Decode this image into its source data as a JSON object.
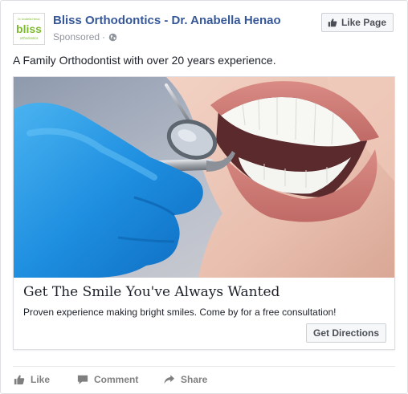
{
  "post": {
    "page_name": "Bliss Orthodontics - Dr. Anabella Henao",
    "sponsored_label": "Sponsored",
    "separator": "·",
    "like_page_label": "Like Page",
    "body_text": "A Family Orthodontist with over 20 years experience.",
    "logo": {
      "top_text": "Dr. Anabella Henao",
      "main_text": "bliss",
      "bottom_text": "orthodontics",
      "color": "#7dbb2e"
    }
  },
  "ad": {
    "image_icon": "dental-exam-photo",
    "headline": "Get The Smile You've Always Wanted",
    "description": "Proven experience making bright smiles. Come by for a free consultation!",
    "cta_label": "Get Directions"
  },
  "actions": {
    "like_label": "Like",
    "comment_label": "Comment",
    "share_label": "Share"
  },
  "colors": {
    "link_blue": "#365899",
    "meta_gray": "#90949c",
    "action_gray": "#7f7f7f",
    "button_bg": "#f6f7f9",
    "border": "#dddfe2"
  }
}
